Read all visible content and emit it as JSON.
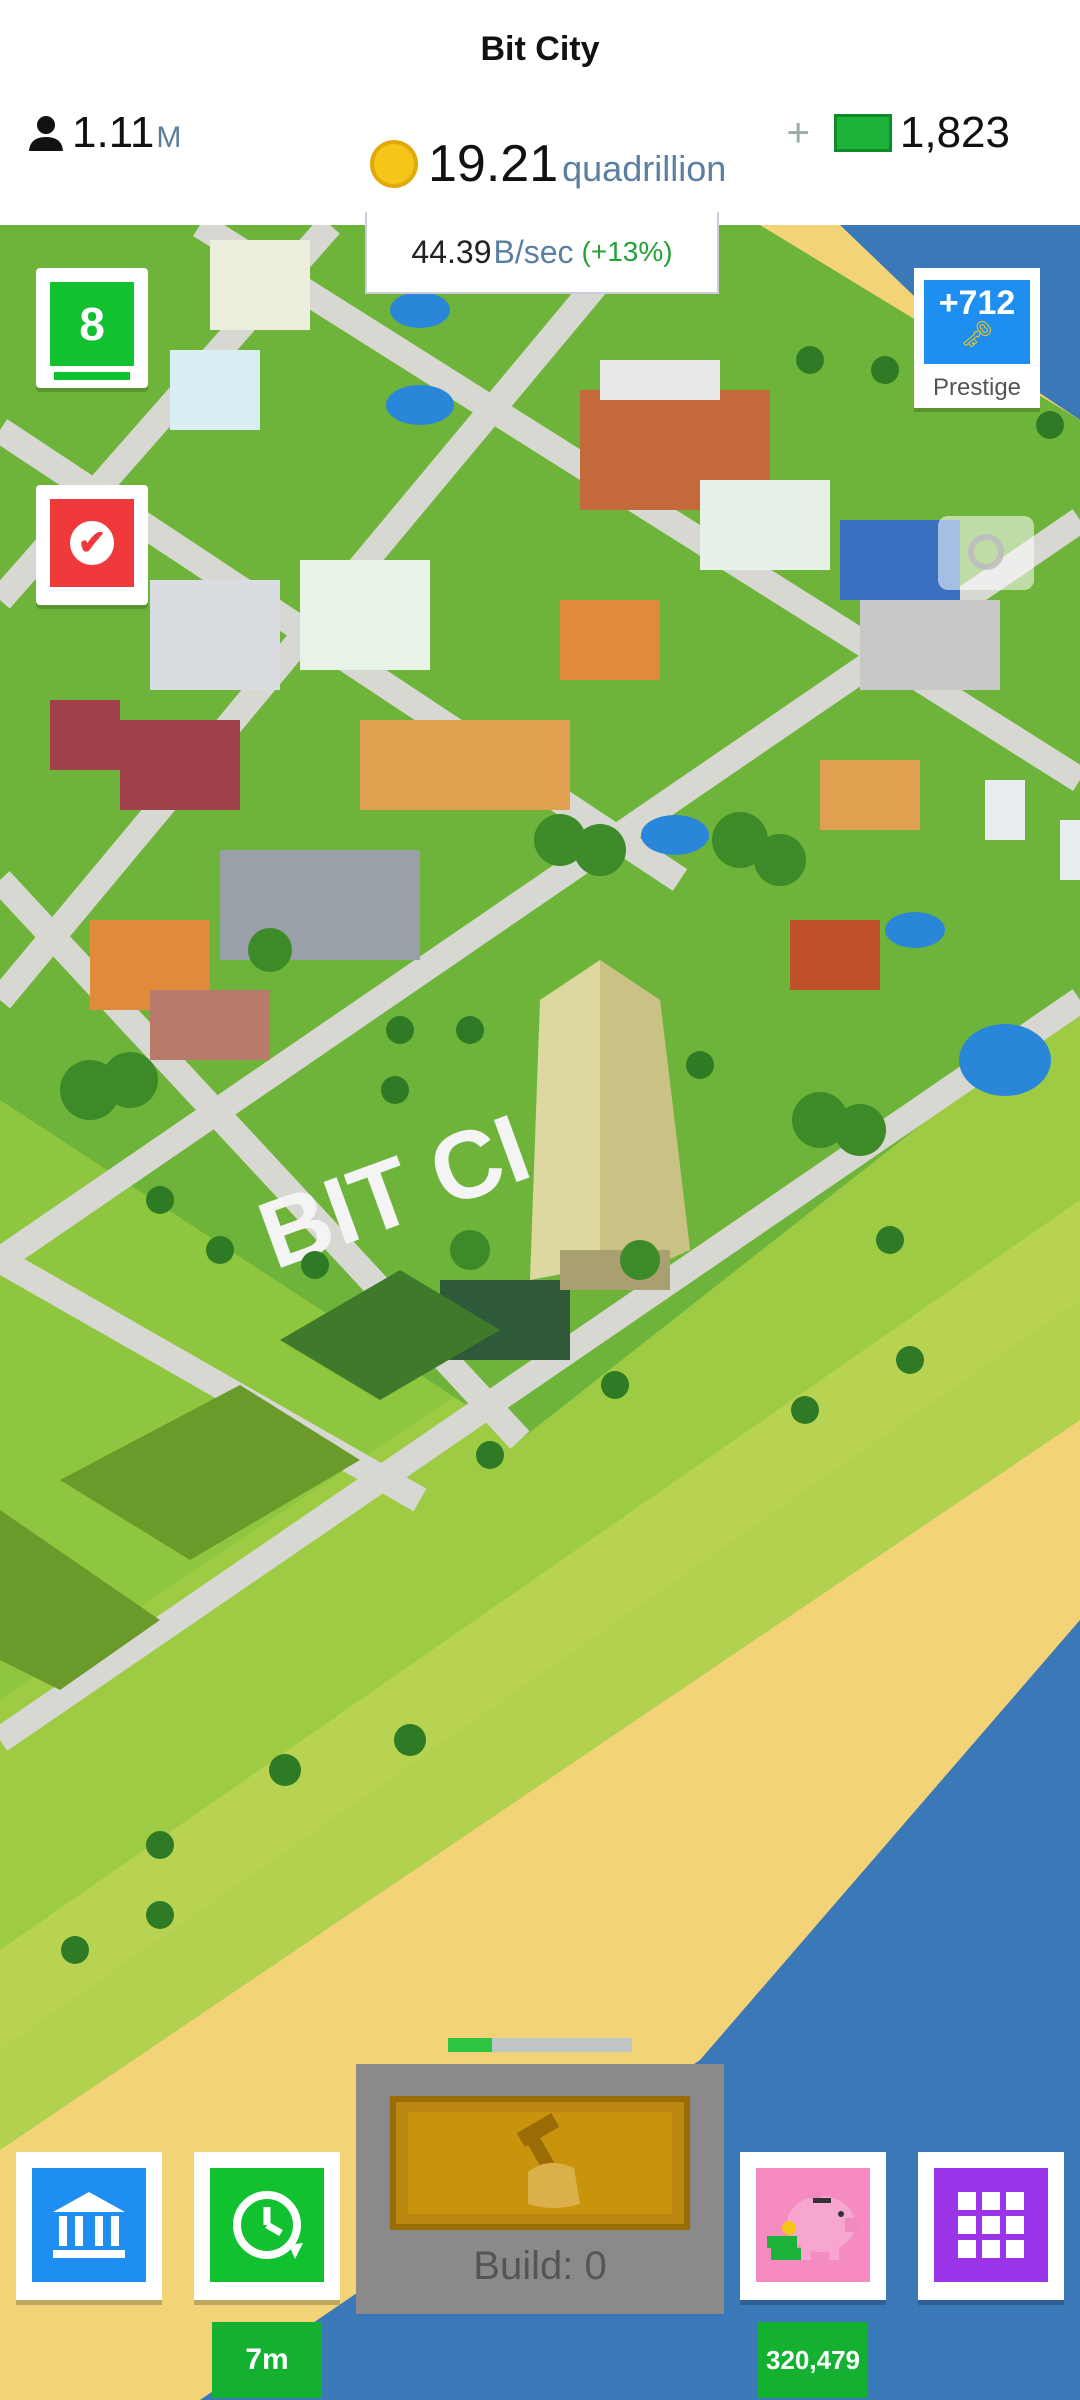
{
  "header": {
    "title": "Bit City",
    "population": {
      "value": "1.11",
      "suffix": "M"
    },
    "money": {
      "value": "19.21",
      "unit": "quadrillion"
    },
    "cash": {
      "plus": "+",
      "value": "1,823"
    },
    "rate": {
      "value": "44.39",
      "unit": "B/sec",
      "bonus": "(+13%)"
    }
  },
  "left_badges": {
    "level": "8",
    "tasks_icon": "check-icon"
  },
  "prestige": {
    "value": "+712",
    "label": "Prestige",
    "icon": "key-icon"
  },
  "map": {
    "sign_text": "BIT CI"
  },
  "bottom_bar": {
    "bank_icon": "bank-icon",
    "boost_icon": "clock-icon",
    "boost_timer": "7m",
    "build_label": "Build: 0",
    "build_progress": 0.24,
    "piggy_icon": "piggy-bank-icon",
    "piggy_value": "320,479",
    "menu_icon": "grid-icon"
  },
  "colors": {
    "grass": "#8ec63f",
    "sand": "#f2d378",
    "water": "#3a78b8",
    "accent_green": "#12c12f",
    "accent_blue": "#1e8ef0",
    "accent_red": "#f0393a",
    "accent_purple": "#9b34e8",
    "accent_pink": "#f58bc0"
  }
}
